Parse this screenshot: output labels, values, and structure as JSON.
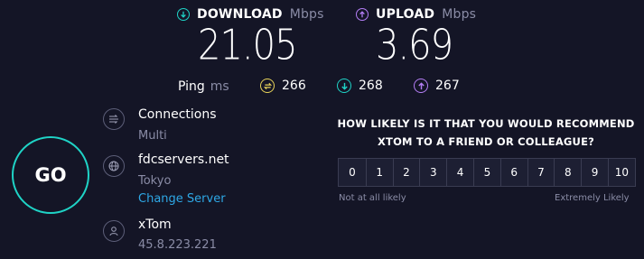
{
  "download": {
    "label": "DOWNLOAD",
    "unit": "Mbps",
    "value": "21.05",
    "icon": "download-arrow-icon",
    "color": "#1fd3c6"
  },
  "upload": {
    "label": "UPLOAD",
    "unit": "Mbps",
    "value": "3.69",
    "icon": "upload-arrow-icon",
    "color": "#b47ef5"
  },
  "ping": {
    "label": "Ping",
    "unit": "ms",
    "idle": {
      "value": "266",
      "icon": "idle-latency-icon",
      "color": "#e8d35a"
    },
    "download": {
      "value": "268",
      "icon": "download-latency-icon",
      "color": "#1fd3c6"
    },
    "upload": {
      "value": "267",
      "icon": "upload-latency-icon",
      "color": "#b47ef5"
    }
  },
  "go_button": {
    "label": "GO",
    "ring_color": "#1fd3c6"
  },
  "connections": {
    "title": "Connections",
    "value": "Multi",
    "icon": "connections-icon"
  },
  "server": {
    "title": "fdcservers.net",
    "location": "Tokyo",
    "change_link": "Change Server",
    "icon": "globe-icon"
  },
  "provider": {
    "title": "xTom",
    "ip": "45.8.223.221",
    "icon": "user-icon"
  },
  "survey": {
    "question_line1": "HOW LIKELY IS IT THAT YOU WOULD RECOMMEND",
    "question_line2": "XTOM TO A FRIEND OR COLLEAGUE?",
    "scale": [
      "0",
      "1",
      "2",
      "3",
      "4",
      "5",
      "6",
      "7",
      "8",
      "9",
      "10"
    ],
    "low_label": "Not at all likely",
    "high_label": "Extremely Likely"
  }
}
